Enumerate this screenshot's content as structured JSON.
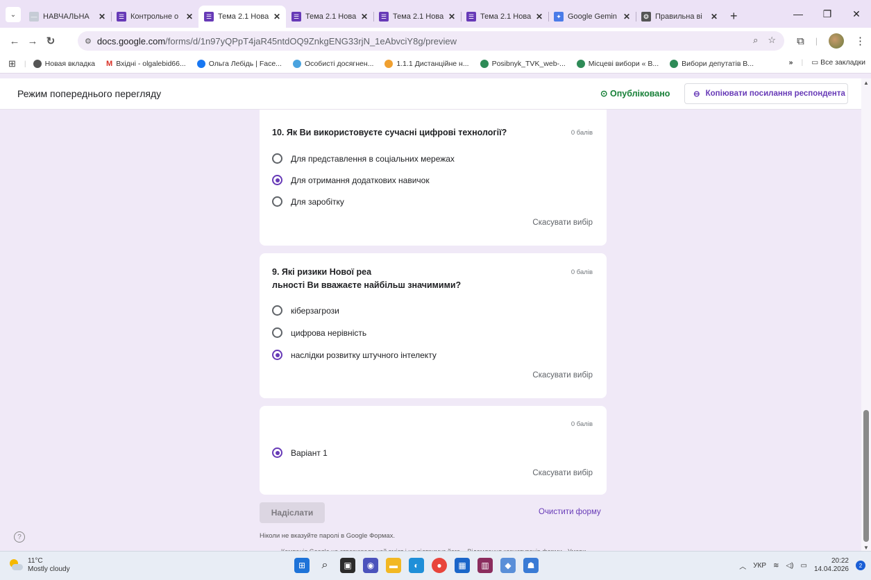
{
  "browser": {
    "tabs": [
      {
        "title": "НАВЧАЛЬНА",
        "fav_color": "#c6ccd6",
        "fav_glyph": "—"
      },
      {
        "title": "Контрольне о",
        "fav_color": "#673ab7",
        "fav_glyph": "☰"
      },
      {
        "title": "Тема 2.1 Нова",
        "fav_color": "#673ab7",
        "fav_glyph": "☰",
        "active": true
      },
      {
        "title": "Тема 2.1 Нова",
        "fav_color": "#673ab7",
        "fav_glyph": "☰"
      },
      {
        "title": "Тема 2.1 Нова",
        "fav_color": "#673ab7",
        "fav_glyph": "☰"
      },
      {
        "title": "Тема 2.1 Нова",
        "fav_color": "#673ab7",
        "fav_glyph": "☰"
      },
      {
        "title": "Google Gemin",
        "fav_color": "#4a7be8",
        "fav_glyph": "✦"
      },
      {
        "title": "Правильна ві",
        "fav_color": "#555555",
        "fav_glyph": "❂"
      }
    ],
    "url_host": "docs.google.com",
    "url_path": "/forms/d/1n97yQPpT4jaR45ntdOQ9ZnkgENG33rjN_1eAbvciY8g/preview",
    "bookmarks": [
      {
        "label": "Новая вкладка",
        "color": "#555555"
      },
      {
        "label": "Вхідні - olgalebid66...",
        "color": "#d93025",
        "glyph": "M"
      },
      {
        "label": "Ольга Лебідь | Face...",
        "color": "#1877f2"
      },
      {
        "label": "Особисті досягнен...",
        "color": "#4aa3df"
      },
      {
        "label": "1.1.1 Дистанційне н...",
        "color": "#f0a030"
      },
      {
        "label": "Posibnyk_TVK_web-...",
        "color": "#2e8b57"
      },
      {
        "label": "Місцеві вибори « В...",
        "color": "#2e8b57"
      },
      {
        "label": "Вибори депутатів В...",
        "color": "#2e8b57"
      }
    ],
    "all_bookmarks": "Все закладки"
  },
  "header": {
    "title": "Режим попереднього перегляду",
    "published": "Опубліковано",
    "copy_link": "Копіювати посилання респондента"
  },
  "questions": [
    {
      "title": "10. Як Ви використовуєте сучасні цифрові технології?",
      "points": "0 балів",
      "options": [
        {
          "label": "Для представлення в соціальних мережах",
          "checked": false
        },
        {
          "label": "Для отримання додаткових навичок",
          "checked": true
        },
        {
          "label": "Для заробітку",
          "checked": false
        }
      ],
      "clear": "Скасувати вибір"
    },
    {
      "title_line1": "9. Які ризики Нової реа",
      "title_line2": "льності Ви вважаєте найбільш значимими?",
      "points": "0 балів",
      "options": [
        {
          "label": "кіберзагрози",
          "checked": false
        },
        {
          "label": "цифрова нерівність",
          "checked": false
        },
        {
          "label": "наслідки розвитку штучного інтелекту",
          "checked": true
        }
      ],
      "clear": "Скасувати вибір"
    },
    {
      "points": "0 балів",
      "options": [
        {
          "label": "Варіант 1",
          "checked": true
        }
      ],
      "clear": "Скасувати вибір"
    }
  ],
  "form_footer": {
    "submit": "Надіслати",
    "clear_form": "Очистити форму",
    "never_passwords": "Ніколи не вказуйте паролі в Google Формах.",
    "cut_text": "Компанія Google не створювала цей вміст і не підтримує його. - Відомлення користувачів форми - Умови"
  },
  "taskbar": {
    "temperature": "11°C",
    "weather": "Mostly cloudy",
    "lang": "УКР",
    "time": "20:22",
    "date": "14.04.2026",
    "notifications": "2"
  }
}
